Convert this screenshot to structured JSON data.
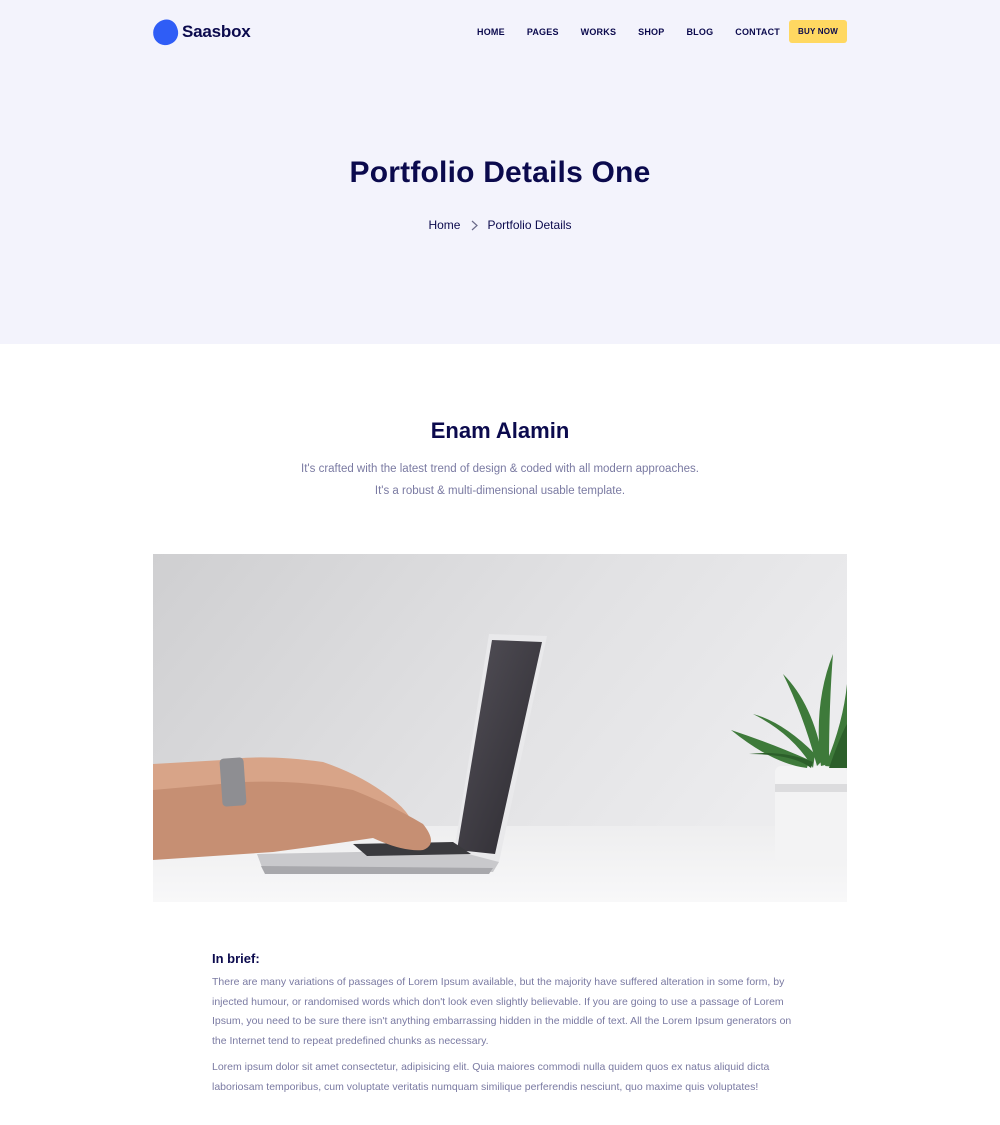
{
  "brand": {
    "name": "Saasbox",
    "accent": "#2f5df6",
    "text_color": "#0b0a4d"
  },
  "nav": {
    "items": [
      "HOME",
      "PAGES",
      "WORKS",
      "SHOP",
      "BLOG",
      "CONTACT"
    ],
    "cta_label": "BUY NOW",
    "cta_color": "#ffd861"
  },
  "hero": {
    "title": "Portfolio Details One",
    "background": "#f3f3fc",
    "breadcrumb": {
      "home": "Home",
      "separator_icon": "chevron-right-icon",
      "current": "Portfolio Details"
    }
  },
  "project": {
    "author": "Enam Alamin",
    "intro": "It's crafted with the latest trend of design & coded with all modern approaches. It's a robust & multi-dimensional usable template.",
    "image_subject": "hands typing on a laptop beside a potted plant"
  },
  "brief": {
    "heading": "In brief:",
    "paragraphs": [
      "There are many variations of passages of Lorem Ipsum available, but the majority have suffered alteration in some form, by injected humour, or randomised words which don't look even slightly believable. If you are going to use a passage of Lorem Ipsum, you need to be sure there isn't anything embarrassing hidden in the middle of text. All the Lorem Ipsum generators on the Internet tend to repeat predefined chunks as necessary.",
      "Lorem ipsum dolor sit amet consectetur, adipisicing elit. Quia maiores commodi nulla quidem quos ex natus aliquid dicta laboriosam temporibus, cum voluptate veritatis numquam similique perferendis nesciunt, quo maxime quis voluptates!"
    ]
  }
}
